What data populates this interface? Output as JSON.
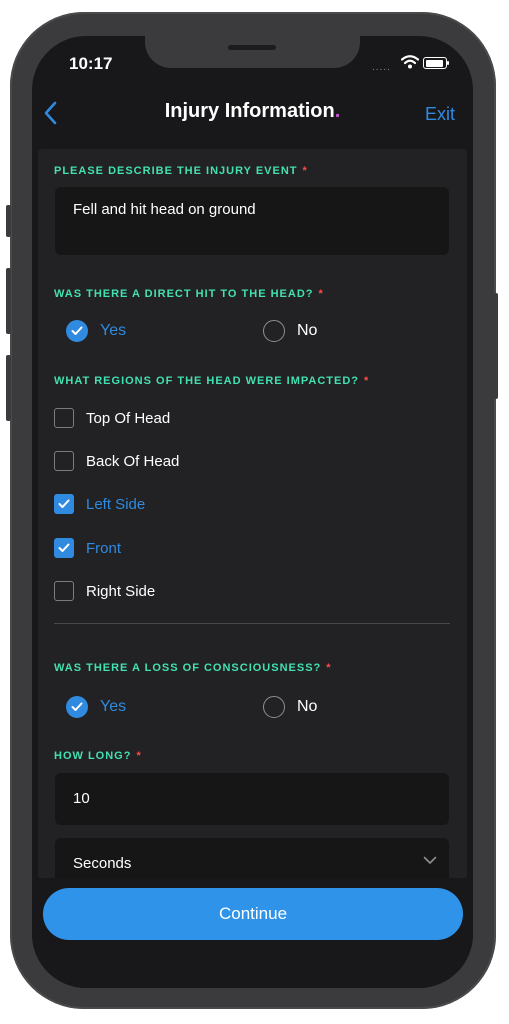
{
  "status_bar": {
    "time": "10:17",
    "signal": "....."
  },
  "nav": {
    "title": "Injury Information",
    "title_dot": ".",
    "exit_label": "Exit"
  },
  "form": {
    "required_mark": "*",
    "injury_event": {
      "label": "PLEASE DESCRIBE THE INJURY EVENT",
      "value": "Fell and hit head on ground"
    },
    "direct_hit": {
      "label": "WAS THERE A DIRECT HIT TO THE HEAD?",
      "options": [
        "Yes",
        "No"
      ],
      "selected": "Yes"
    },
    "regions": {
      "label": "WHAT REGIONS OF THE HEAD WERE IMPACTED?",
      "options": [
        {
          "label": "Top Of Head",
          "checked": false
        },
        {
          "label": "Back Of Head",
          "checked": false
        },
        {
          "label": "Left Side",
          "checked": true
        },
        {
          "label": "Front",
          "checked": true
        },
        {
          "label": "Right Side",
          "checked": false
        }
      ]
    },
    "loss_of_consciousness": {
      "label": "WAS THERE A LOSS OF CONSCIOUSNESS?",
      "options": [
        "Yes",
        "No"
      ],
      "selected": "Yes"
    },
    "how_long": {
      "label": "HOW LONG?",
      "value": "10",
      "unit": "Seconds"
    }
  },
  "continue_label": "Continue",
  "colors": {
    "accent": "#2f8ae0",
    "label": "#43e0b0",
    "required": "#ff4b4b",
    "background": "#18181a",
    "panel": "#222224"
  }
}
